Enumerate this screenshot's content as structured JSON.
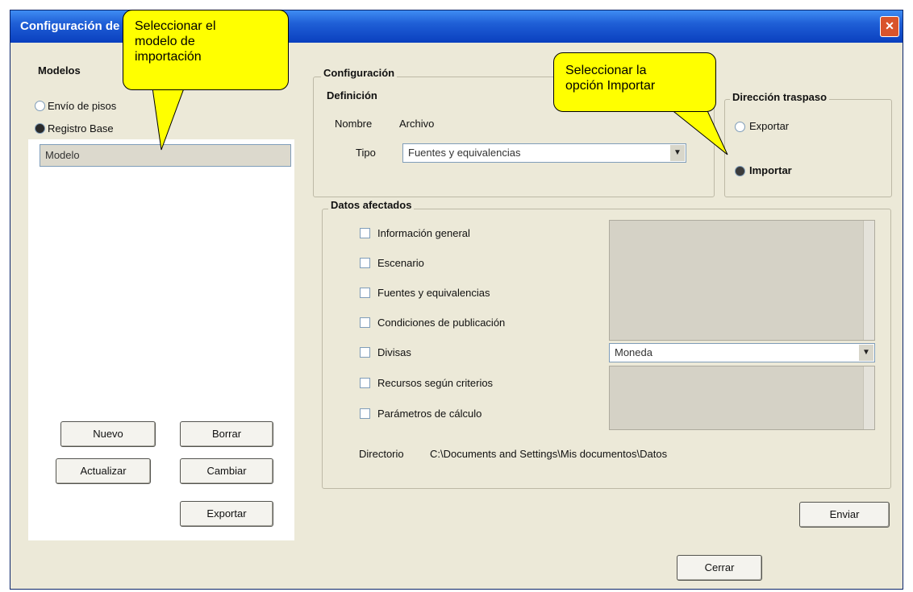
{
  "window": {
    "title": "Configuración de importación"
  },
  "left": {
    "group_title": "Modelos",
    "radio_1": "Envío de pisos",
    "radio_2": "Registro Base",
    "selected_model": "Modelo",
    "buttons": {
      "new": "Nuevo",
      "delete": "Borrar",
      "update": "Actualizar",
      "rename": "Cambiar",
      "export": "Exportar"
    }
  },
  "config": {
    "group_title": "Configuración",
    "definition_title": "Definición",
    "name_label": "Nombre",
    "name_value": "Archivo",
    "type_label": "Tipo",
    "type_value": "Fuentes y equivalencias"
  },
  "direction": {
    "title": "Dirección traspaso",
    "export_label": "Exportar",
    "import_label": "Importar"
  },
  "data": {
    "group_title": "Datos afectados",
    "items": [
      {
        "label": "Información general"
      },
      {
        "label": "Escenario"
      },
      {
        "label": "Fuentes y equivalencias"
      },
      {
        "label": "Condiciones de publicación"
      },
      {
        "label": "Divisas"
      },
      {
        "label": "Recursos según criterios"
      },
      {
        "label": "Parámetros de cálculo"
      }
    ],
    "divisas_value": "Moneda",
    "directory_label": "Directorio",
    "directory_value": "C:\\Documents and Settings\\Mis documentos\\Datos"
  },
  "buttons": {
    "send": "Enviar",
    "close": "Cerrar"
  },
  "callouts": {
    "model": [
      "Seleccionar el",
      "modelo de",
      "importación"
    ],
    "import": [
      "Seleccionar la",
      "opción Importar"
    ]
  },
  "colors": {
    "title_bar": "#1f5fd6",
    "window_bg": "#ECE9D8",
    "callout_fill": "#ffff00"
  },
  "icons": {
    "close": "close-icon",
    "dropdown": "chevron-down-icon"
  }
}
